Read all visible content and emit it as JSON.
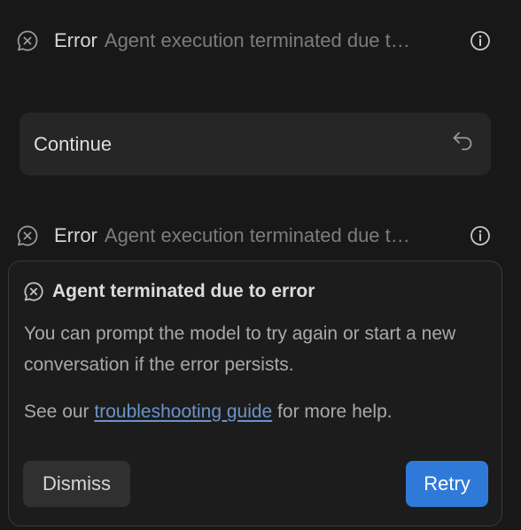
{
  "error_rows": [
    {
      "label": "Error",
      "message": "Agent execution terminated due to error",
      "icon": "error-bubble-icon",
      "info_icon": "info-icon"
    },
    {
      "label": "Error",
      "message": "Agent execution terminated due to error",
      "icon": "error-bubble-icon",
      "info_icon": "info-icon"
    }
  ],
  "continue_prompt": {
    "label": "Continue",
    "icon": "undo-icon"
  },
  "error_panel": {
    "icon": "error-bubble-icon",
    "title": "Agent terminated due to error",
    "body": "You can prompt the model to try again or start a new conversation if the error persists.",
    "help_prefix": "See our ",
    "help_link": "troubleshooting guide",
    "help_suffix": " for more help.",
    "dismiss_label": "Dismiss",
    "retry_label": "Retry"
  },
  "colors": {
    "background": "#181818",
    "link": "#6b93c7",
    "primary_button": "#2f7ad8",
    "secondary_button": "#303030"
  }
}
